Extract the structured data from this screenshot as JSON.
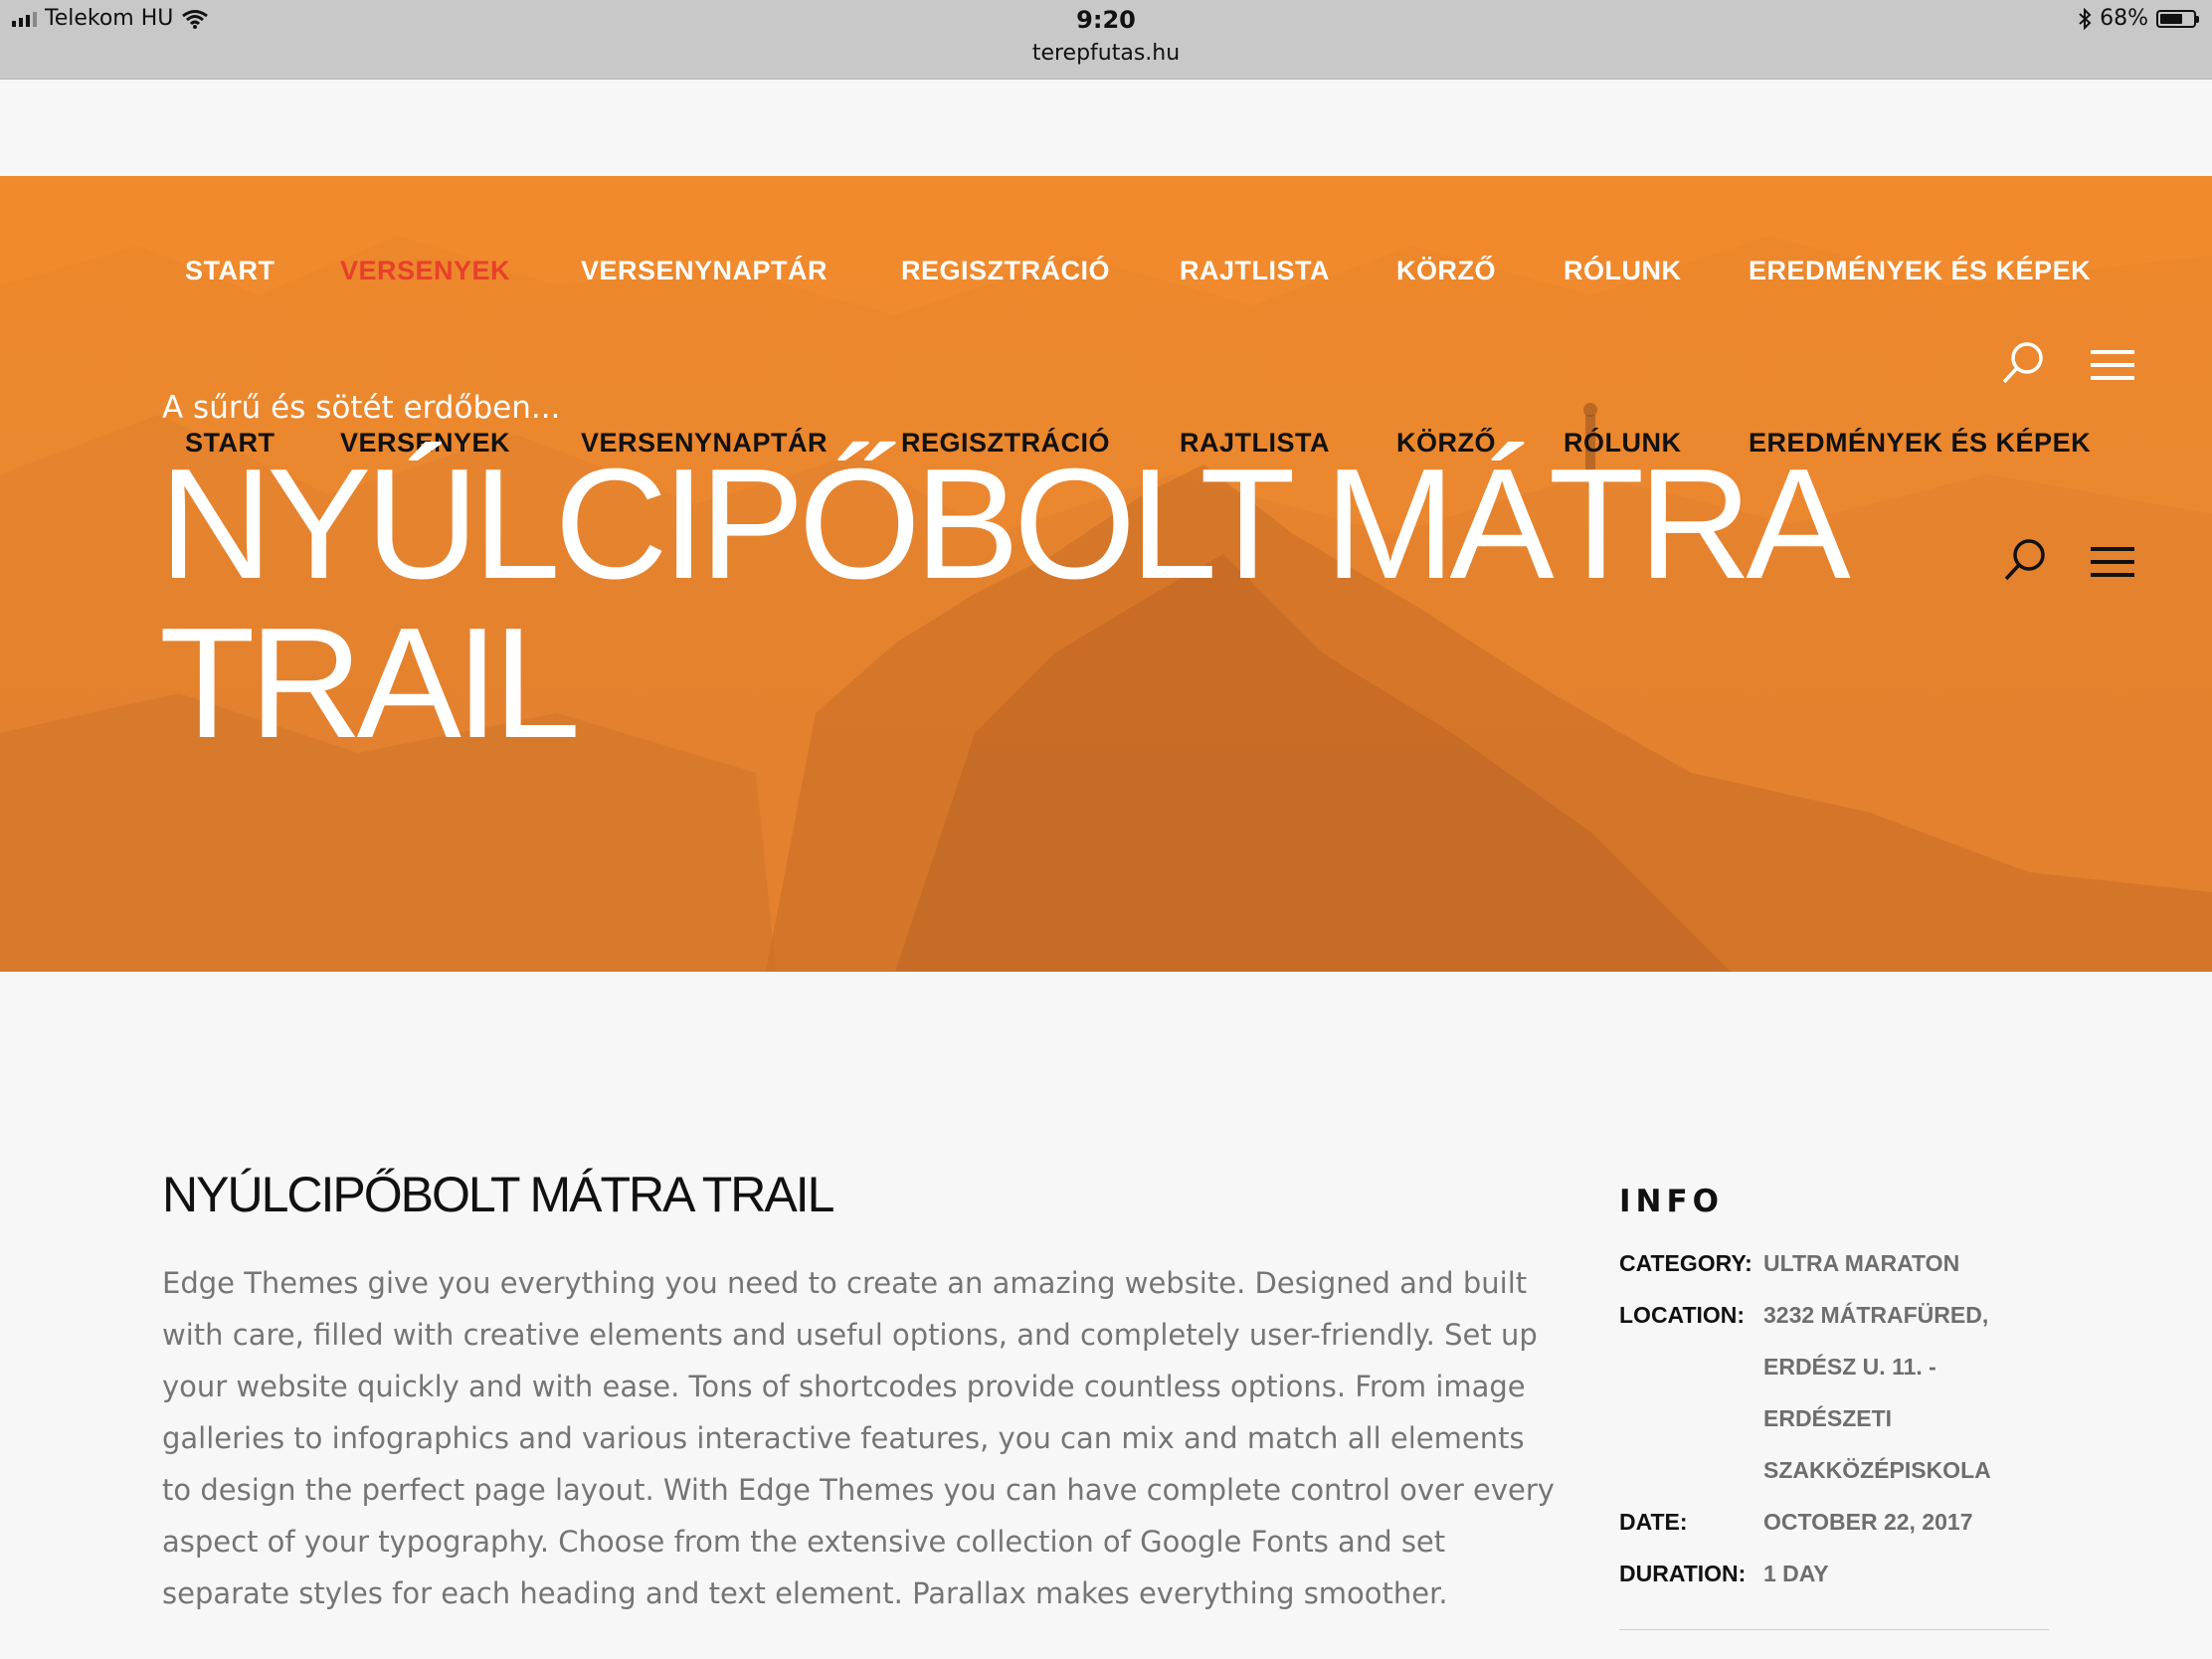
{
  "status_bar": {
    "carrier": "Telekom HU",
    "time": "9:20",
    "url": "terepfutas.hu",
    "battery_percent": "68%",
    "battery_level": 0.68
  },
  "nav": {
    "items": [
      "START",
      "VERSENYEK",
      "VERSENYNAPTÁR",
      "REGISZTRÁCIÓ",
      "RAJTLISTA",
      "KÖRZŐ",
      "RÓLUNK",
      "EREDMÉNYEK ÉS KÉPEK"
    ],
    "active_item": "VERSENYEK"
  },
  "hero": {
    "tagline": "A sűrű és sötét erdőben...",
    "title_line1": "NYÚLCIPŐBOLT MÁTRA",
    "title_line2": "TRAIL"
  },
  "content": {
    "title": "NYÚLCIPŐBOLT MÁTRA TRAIL",
    "body": "Edge Themes give you everything you need to create an amazing website.  Designed and built with care, filled with creative elements and useful options, and completely user-friendly. Set up your website quickly and with ease. Tons of shortcodes provide countless options. From image galleries to infographics and various interactive features, you can mix and match all elements to design the perfect page layout. With Edge Themes you can have complete control over every aspect of your typography. Choose from the extensive collection of Google Fonts and set separate styles for each heading and text element. Parallax makes everything smoother."
  },
  "info": {
    "heading": "INFO",
    "rows": [
      {
        "key": "CATEGORY:",
        "value": "ULTRA MARATON"
      },
      {
        "key": "LOCATION:",
        "value": "3232 MÁTRAFÜRED,\nERDÉSZ U. 11. -\nERDÉSZETI\nSZAKKÖZÉPISKOLA"
      },
      {
        "key": "DATE:",
        "value": "OCTOBER 22, 2017"
      },
      {
        "key": "DURATION:",
        "value": "1 DAY"
      }
    ]
  },
  "colors": {
    "hero_orange": "#f08a2c",
    "nav_active": "#e8402a",
    "body_text": "#757575"
  },
  "icons": [
    "signal-icon",
    "wifi-icon",
    "bluetooth-icon",
    "battery-icon",
    "search-icon",
    "hamburger-menu-icon"
  ]
}
